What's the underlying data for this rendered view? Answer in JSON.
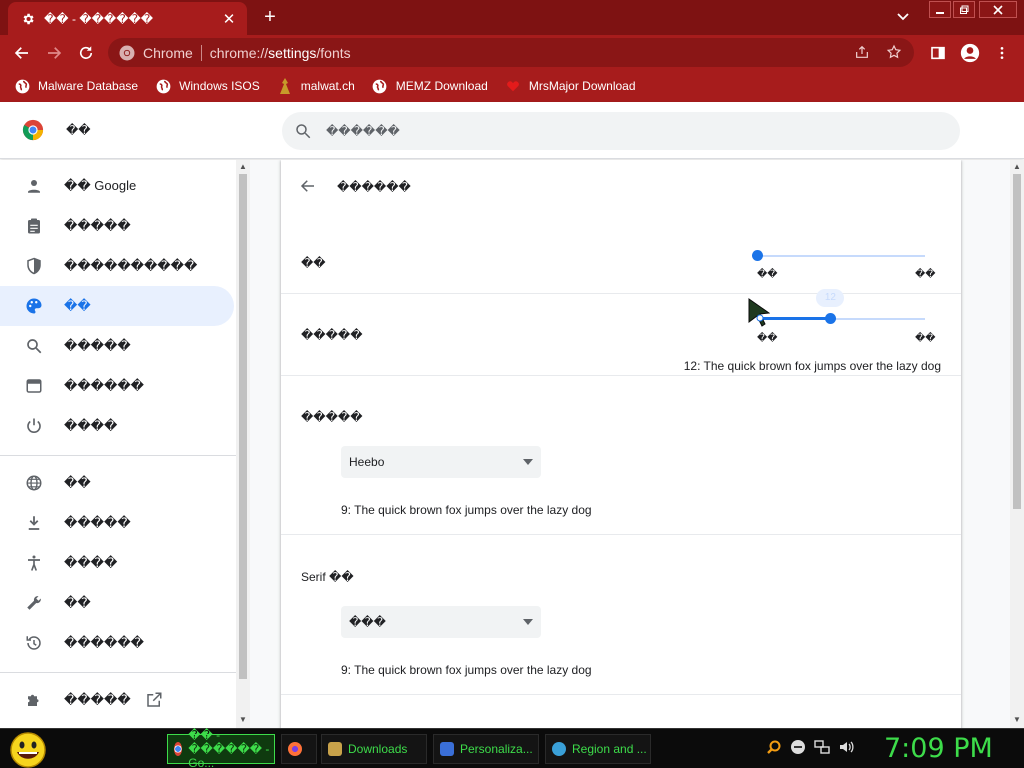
{
  "browser": {
    "tab_title": "�� - ������",
    "new_tab_symbol": "+",
    "omnibox": {
      "site_label": "Chrome",
      "url_prefix": "chrome://",
      "url_main": "settings",
      "url_suffix": "/fonts"
    },
    "bookmarks": [
      {
        "label": "Malware Database",
        "icon": "globe-icon"
      },
      {
        "label": "Windows ISOS",
        "icon": "globe-icon"
      },
      {
        "label": "malwat.ch",
        "icon": "figure-icon"
      },
      {
        "label": "MEMZ Download",
        "icon": "globe-icon"
      },
      {
        "label": "MrsMajor Download",
        "icon": "heart-icon"
      }
    ],
    "theme_color": "#a71c1c",
    "frame_color": "#7e1212"
  },
  "settings_header": {
    "title": "��",
    "search_placeholder": "������"
  },
  "sidebar": {
    "items": [
      {
        "label": "�� Google",
        "icon": "person-icon"
      },
      {
        "label": "�����",
        "icon": "clipboard-icon"
      },
      {
        "label": "����������",
        "icon": "shield-icon"
      },
      {
        "label": "��",
        "icon": "palette-icon",
        "active": true
      },
      {
        "label": "�����",
        "icon": "search-icon"
      },
      {
        "label": "������",
        "icon": "browser-icon"
      },
      {
        "label": "����",
        "icon": "power-icon"
      },
      {
        "label": "��",
        "icon": "globe-icon"
      },
      {
        "label": "�����",
        "icon": "download-icon"
      },
      {
        "label": "����",
        "icon": "accessibility-icon"
      },
      {
        "label": "��",
        "icon": "wrench-icon"
      },
      {
        "label": "������",
        "icon": "history-icon"
      }
    ],
    "extensions": {
      "label": "�����",
      "icon": "puzzle-icon",
      "external_icon": "open-in-new-icon"
    }
  },
  "fonts_page": {
    "title": "������",
    "font_size": {
      "label": "��",
      "min_label": "��",
      "max_label": "��",
      "value_fraction": 0.0
    },
    "min_font_size": {
      "label": "�����",
      "min_label": "��",
      "max_label": "��",
      "value_fraction": 0.43,
      "bubble": "12",
      "sample": "12: The quick brown fox jumps over the lazy dog"
    },
    "standard_font": {
      "label": "�����",
      "selected": "Heebo",
      "sample": "9: The quick brown fox jumps over the lazy dog"
    },
    "serif_font": {
      "label": "Serif ��",
      "selected": "���",
      "sample": "9: The quick brown fox jumps over the lazy dog"
    }
  },
  "taskbar": {
    "buttons": [
      {
        "label": "�� - ������ - Go...",
        "icon": "chrome-icon",
        "active": true
      },
      {
        "label": "",
        "icon": "firefox-icon"
      },
      {
        "label": "Downloads",
        "icon": "folder-icon"
      },
      {
        "label": "Personaliza...",
        "icon": "personalization-icon"
      },
      {
        "label": "Region and ...",
        "icon": "region-icon"
      }
    ],
    "clock": "7:09 PM",
    "accent": "#3ddc4a"
  }
}
